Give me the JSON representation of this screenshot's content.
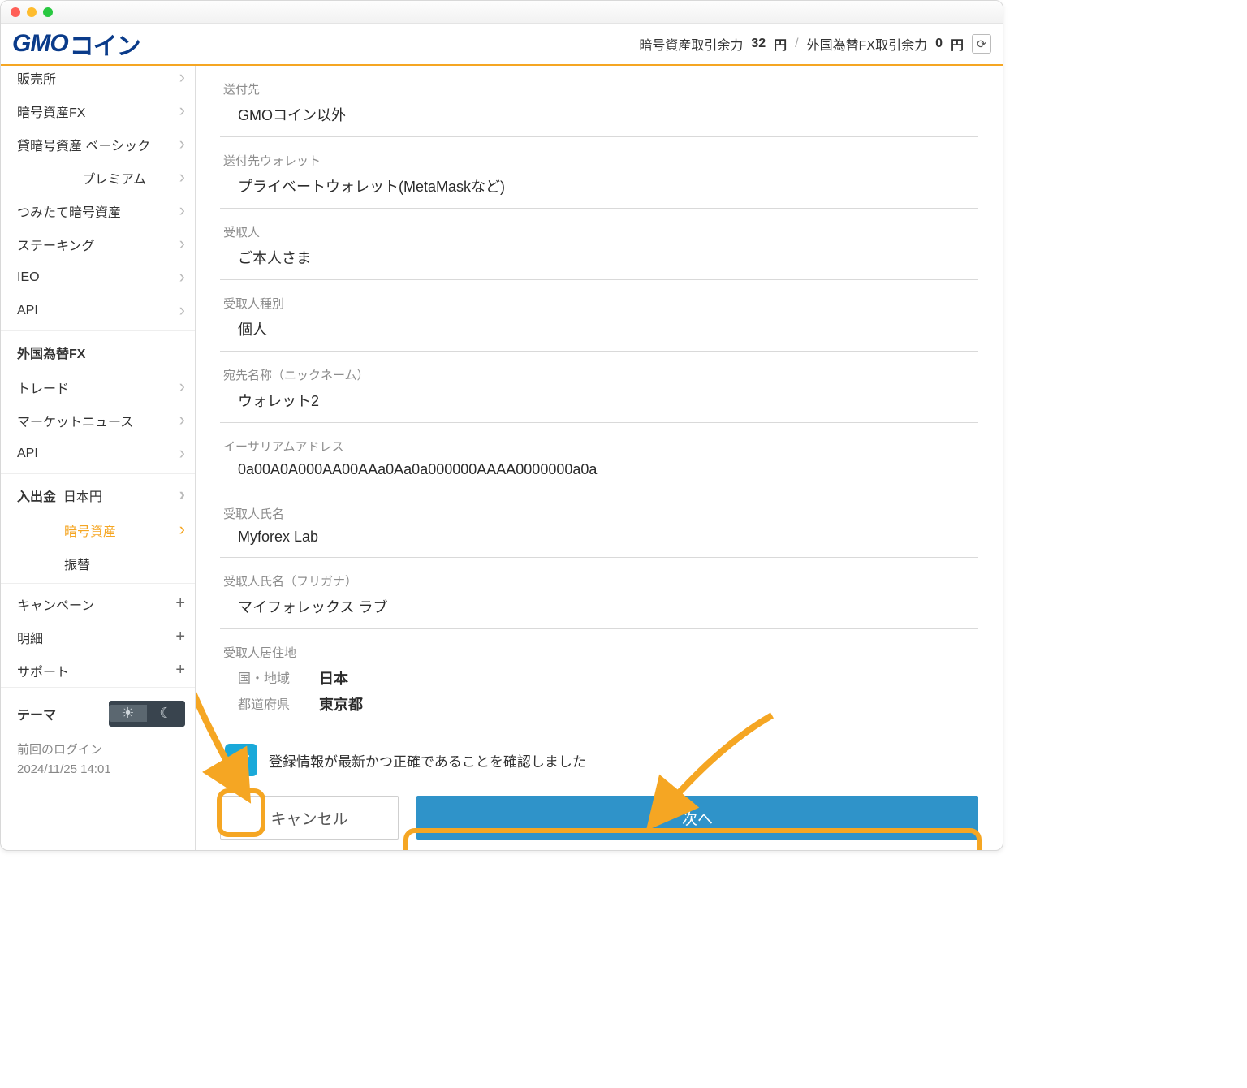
{
  "header": {
    "logo_gmo": "GMO",
    "logo_coin": "コイン",
    "crypto_label": "暗号資産取引余力",
    "crypto_value": "32",
    "crypto_unit": "円",
    "sep": "/",
    "fx_label": "外国為替FX取引余力",
    "fx_value": "0",
    "fx_unit": "円"
  },
  "sidebar": {
    "items": [
      {
        "label": "販売所",
        "type": "chev"
      },
      {
        "label": "暗号資産FX",
        "type": "chev"
      },
      {
        "label": "貸暗号資産  ベーシック",
        "type": "chev"
      },
      {
        "label": "プレミアム",
        "type": "chev",
        "sub": true
      },
      {
        "label": "つみたて暗号資産",
        "type": "chev"
      },
      {
        "label": "ステーキング",
        "type": "chev"
      },
      {
        "label": "IEO",
        "type": "chev"
      },
      {
        "label": "API",
        "type": "chev"
      }
    ],
    "fx_header": "外国為替FX",
    "fx_items": [
      {
        "label": "トレード",
        "type": "chev"
      },
      {
        "label": "マーケットニュース",
        "type": "chev"
      },
      {
        "label": "API",
        "type": "chev"
      }
    ],
    "io_header": "入出金",
    "io_head_suffix": "日本円",
    "io_items": [
      {
        "label": "暗号資産",
        "type": "chev",
        "active": true,
        "sub": true
      },
      {
        "label": "振替",
        "type": "none",
        "sub": true
      }
    ],
    "extra": [
      {
        "label": "キャンペーン",
        "type": "plus"
      },
      {
        "label": "明細",
        "type": "plus"
      },
      {
        "label": "サポート",
        "type": "plus"
      }
    ],
    "theme_label": "テーマ",
    "last_login_label": "前回のログイン",
    "last_login_value": "2024/11/25 14:01"
  },
  "form": {
    "fields": [
      {
        "label": "送付先",
        "value": "GMOコイン以外"
      },
      {
        "label": "送付先ウォレット",
        "value": "プライベートウォレット(MetaMaskなど)"
      },
      {
        "label": "受取人",
        "value": "ご本人さま"
      },
      {
        "label": "受取人種別",
        "value": "個人"
      },
      {
        "label": "宛先名称（ニックネーム）",
        "value": "ウォレット2"
      },
      {
        "label": "イーサリアムアドレス",
        "value": "0a00A0A000AA00AAa0Aa0a000000AAAA0000000a0a"
      },
      {
        "label": "受取人氏名",
        "value": "Myforex Lab"
      },
      {
        "label": "受取人氏名（フリガナ）",
        "value": "マイフォレックス ラブ"
      }
    ],
    "residence": {
      "label": "受取人居住地",
      "country_k": "国・地域",
      "country_v": "日本",
      "pref_k": "都道府県",
      "pref_v": "東京都"
    },
    "confirm_text": "登録情報が最新かつ正確であることを確認しました",
    "cancel": "キャンセル",
    "next": "次へ"
  }
}
